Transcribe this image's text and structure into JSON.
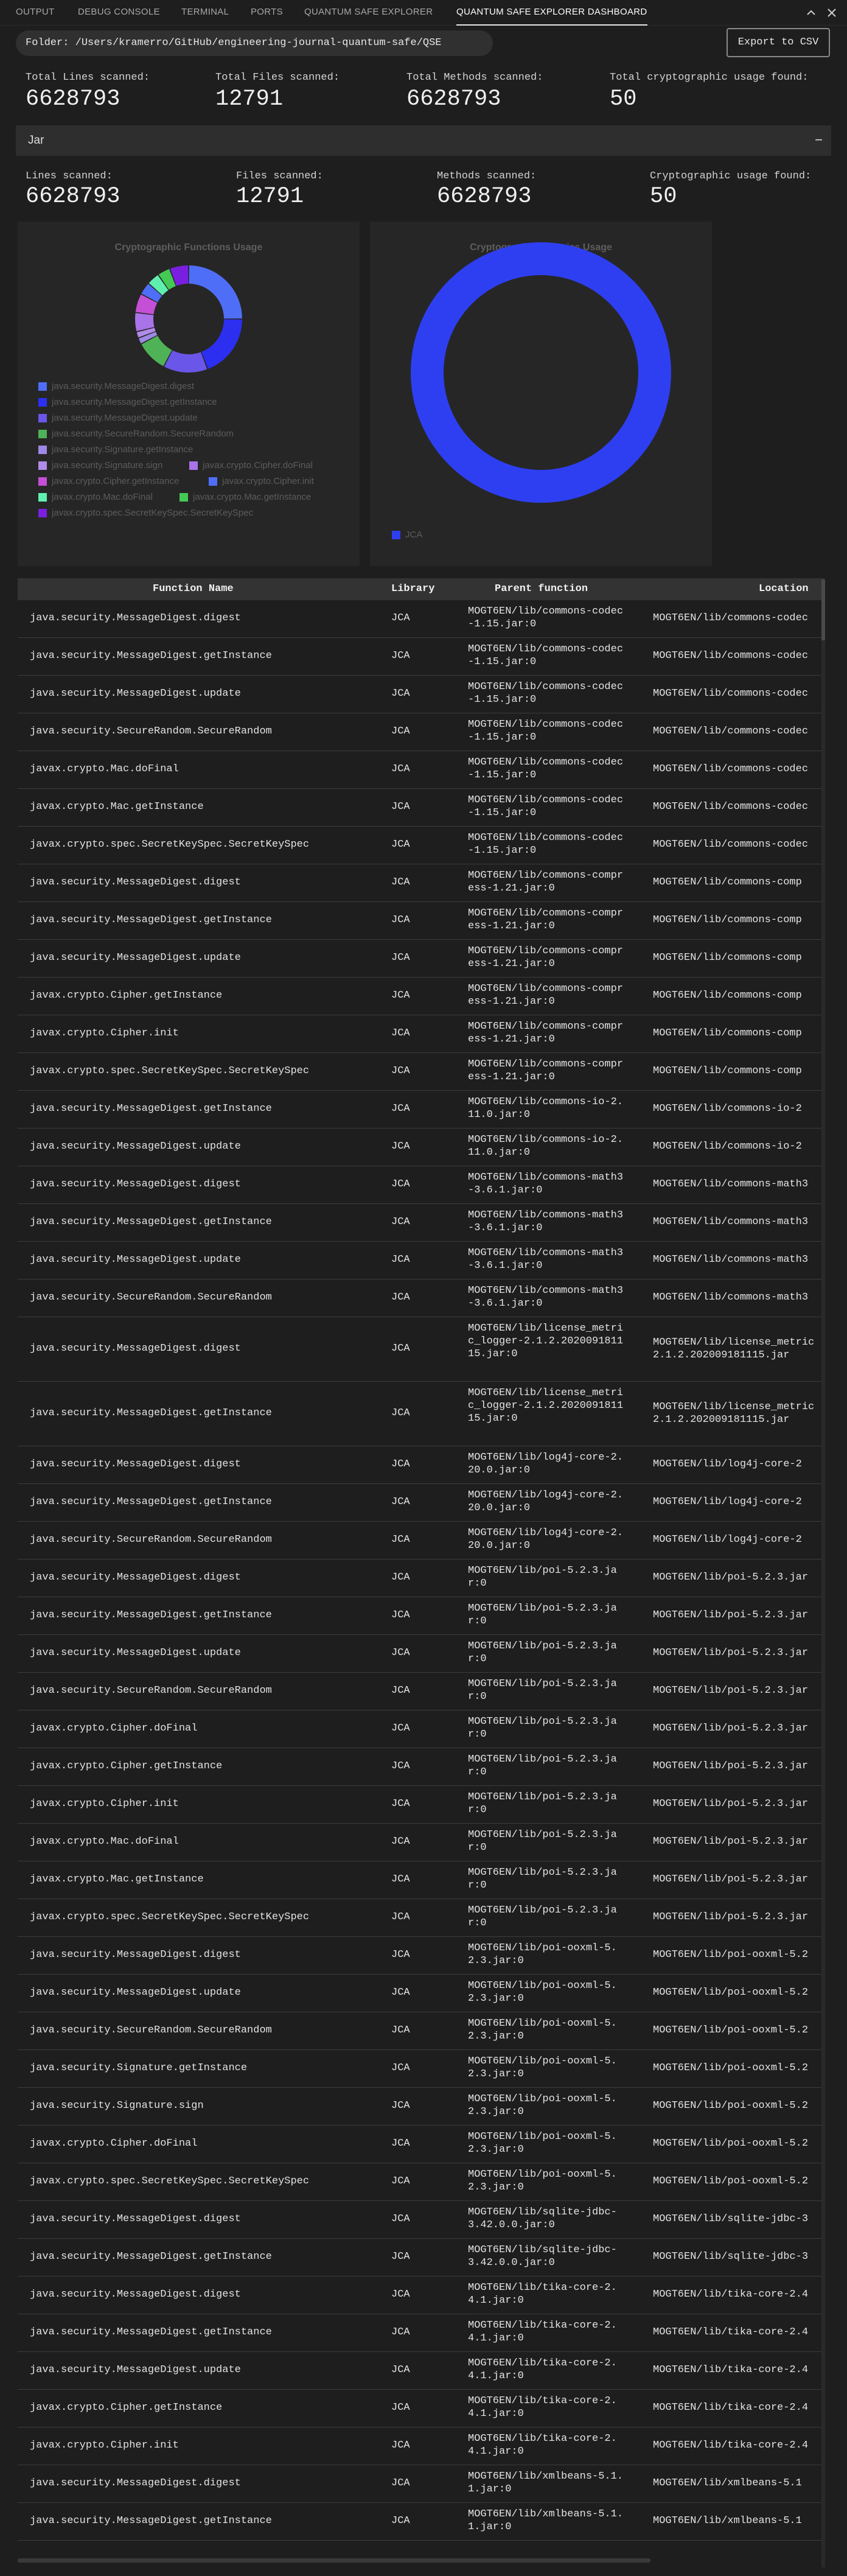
{
  "panel_tabs": [
    {
      "label": "OUTPUT",
      "active": false
    },
    {
      "label": "DEBUG CONSOLE",
      "active": false
    },
    {
      "label": "TERMINAL",
      "active": false
    },
    {
      "label": "PORTS",
      "active": false
    },
    {
      "label": "QUANTUM SAFE EXPLORER",
      "active": false
    },
    {
      "label": "QUANTUM SAFE EXPLORER DASHBOARD",
      "active": true
    }
  ],
  "panel_icons": [
    "chevron-up-icon",
    "close-icon"
  ],
  "folder": {
    "text": "Folder: /Users/kramerro/GitHub/engineering-journal-quantum-safe/QSE"
  },
  "export_button": {
    "label": "Export to CSV"
  },
  "totals": {
    "lines_label": "Total Lines scanned:",
    "lines_value": "6628793",
    "files_label": "Total Files scanned:",
    "files_value": "12791",
    "methods_label": "Total Methods scanned:",
    "methods_value": "6628793",
    "crypto_label": "Total cryptographic usage found:",
    "crypto_value": "50"
  },
  "jar_section": {
    "title": "Jar",
    "toggle": "−",
    "lines_label": "Lines scanned:",
    "lines_value": "6628793",
    "files_label": "Files scanned:",
    "files_value": "12791",
    "methods_label": "Methods scanned:",
    "methods_value": "6628793",
    "crypto_label": "Cryptographic usage found:",
    "crypto_value": "50"
  },
  "chart_data": [
    {
      "type": "pie",
      "title": "Cryptographic Functions Usage",
      "categories": [
        "java.security.MessageDigest.digest",
        "java.security.MessageDigest.getInstance",
        "java.security.MessageDigest.update",
        "java.security.SecureRandom.SecureRandom",
        "java.security.Signature.getInstance",
        "java.security.Signature.sign",
        "javax.crypto.Cipher.doFinal",
        "javax.crypto.Cipher.getInstance",
        "javax.crypto.Cipher.init",
        "javax.crypto.Mac.doFinal",
        "javax.crypto.Mac.getInstance",
        "javax.crypto.spec.SecretKeySpec.SecretKeySpec"
      ],
      "values": [
        13,
        10,
        7,
        5,
        1,
        1,
        3,
        3,
        2,
        2,
        2,
        3
      ],
      "colors": [
        "#4f6ef7",
        "#2c2ff0",
        "#6a56e8",
        "#4fb257",
        "#9d88e6",
        "#b18be9",
        "#a973ea",
        "#c54fd6",
        "#4f6ef7",
        "#5ff0b0",
        "#45c955",
        "#7a1fe0"
      ],
      "legend_position": "bottom"
    },
    {
      "type": "pie",
      "title": "Cryptographic Libraries Usage",
      "categories": [
        "JCA"
      ],
      "values": [
        50
      ],
      "colors": [
        "#2e3ff2"
      ],
      "legend_position": "bottom"
    }
  ],
  "table": {
    "columns": [
      "Function Name",
      "Library",
      "Parent function",
      "Location"
    ],
    "rows": [
      [
        "java.security.MessageDigest.digest",
        "JCA",
        "MOGT6EN/lib/commons-codec-1.15.jar:0",
        "MOGT6EN/lib/commons-codec"
      ],
      [
        "java.security.MessageDigest.getInstance",
        "JCA",
        "MOGT6EN/lib/commons-codec-1.15.jar:0",
        "MOGT6EN/lib/commons-codec"
      ],
      [
        "java.security.MessageDigest.update",
        "JCA",
        "MOGT6EN/lib/commons-codec-1.15.jar:0",
        "MOGT6EN/lib/commons-codec"
      ],
      [
        "java.security.SecureRandom.SecureRandom",
        "JCA",
        "MOGT6EN/lib/commons-codec-1.15.jar:0",
        "MOGT6EN/lib/commons-codec"
      ],
      [
        "javax.crypto.Mac.doFinal",
        "JCA",
        "MOGT6EN/lib/commons-codec-1.15.jar:0",
        "MOGT6EN/lib/commons-codec"
      ],
      [
        "javax.crypto.Mac.getInstance",
        "JCA",
        "MOGT6EN/lib/commons-codec-1.15.jar:0",
        "MOGT6EN/lib/commons-codec"
      ],
      [
        "javax.crypto.spec.SecretKeySpec.SecretKeySpec",
        "JCA",
        "MOGT6EN/lib/commons-codec-1.15.jar:0",
        "MOGT6EN/lib/commons-codec"
      ],
      [
        "java.security.MessageDigest.digest",
        "JCA",
        "MOGT6EN/lib/commons-compress-1.21.jar:0",
        "MOGT6EN/lib/commons-comp"
      ],
      [
        "java.security.MessageDigest.getInstance",
        "JCA",
        "MOGT6EN/lib/commons-compress-1.21.jar:0",
        "MOGT6EN/lib/commons-comp"
      ],
      [
        "java.security.MessageDigest.update",
        "JCA",
        "MOGT6EN/lib/commons-compress-1.21.jar:0",
        "MOGT6EN/lib/commons-comp"
      ],
      [
        "javax.crypto.Cipher.getInstance",
        "JCA",
        "MOGT6EN/lib/commons-compress-1.21.jar:0",
        "MOGT6EN/lib/commons-comp"
      ],
      [
        "javax.crypto.Cipher.init",
        "JCA",
        "MOGT6EN/lib/commons-compress-1.21.jar:0",
        "MOGT6EN/lib/commons-comp"
      ],
      [
        "javax.crypto.spec.SecretKeySpec.SecretKeySpec",
        "JCA",
        "MOGT6EN/lib/commons-compress-1.21.jar:0",
        "MOGT6EN/lib/commons-comp"
      ],
      [
        "java.security.MessageDigest.getInstance",
        "JCA",
        "MOGT6EN/lib/commons-io-2.11.0.jar:0",
        "MOGT6EN/lib/commons-io-2"
      ],
      [
        "java.security.MessageDigest.update",
        "JCA",
        "MOGT6EN/lib/commons-io-2.11.0.jar:0",
        "MOGT6EN/lib/commons-io-2"
      ],
      [
        "java.security.MessageDigest.digest",
        "JCA",
        "MOGT6EN/lib/commons-math3-3.6.1.jar:0",
        "MOGT6EN/lib/commons-math3"
      ],
      [
        "java.security.MessageDigest.getInstance",
        "JCA",
        "MOGT6EN/lib/commons-math3-3.6.1.jar:0",
        "MOGT6EN/lib/commons-math3"
      ],
      [
        "java.security.MessageDigest.update",
        "JCA",
        "MOGT6EN/lib/commons-math3-3.6.1.jar:0",
        "MOGT6EN/lib/commons-math3"
      ],
      [
        "java.security.SecureRandom.SecureRandom",
        "JCA",
        "MOGT6EN/lib/commons-math3-3.6.1.jar:0",
        "MOGT6EN/lib/commons-math3"
      ],
      [
        "java.security.MessageDigest.digest",
        "JCA",
        "MOGT6EN/lib/license_metric_logger-2.1.2.202009181115.jar:0",
        "MOGT6EN/lib/license_metric|2.1.2.202009181115.jar"
      ],
      [
        "java.security.MessageDigest.getInstance",
        "JCA",
        "MOGT6EN/lib/license_metric_logger-2.1.2.202009181115.jar:0",
        "MOGT6EN/lib/license_metric|2.1.2.202009181115.jar"
      ],
      [
        "java.security.MessageDigest.digest",
        "JCA",
        "MOGT6EN/lib/log4j-core-2.20.0.jar:0",
        "MOGT6EN/lib/log4j-core-2"
      ],
      [
        "java.security.MessageDigest.getInstance",
        "JCA",
        "MOGT6EN/lib/log4j-core-2.20.0.jar:0",
        "MOGT6EN/lib/log4j-core-2"
      ],
      [
        "java.security.SecureRandom.SecureRandom",
        "JCA",
        "MOGT6EN/lib/log4j-core-2.20.0.jar:0",
        "MOGT6EN/lib/log4j-core-2"
      ],
      [
        "java.security.MessageDigest.digest",
        "JCA",
        "MOGT6EN/lib/poi-5.2.3.jar:0",
        "MOGT6EN/lib/poi-5.2.3.jar"
      ],
      [
        "java.security.MessageDigest.getInstance",
        "JCA",
        "MOGT6EN/lib/poi-5.2.3.jar:0",
        "MOGT6EN/lib/poi-5.2.3.jar"
      ],
      [
        "java.security.MessageDigest.update",
        "JCA",
        "MOGT6EN/lib/poi-5.2.3.jar:0",
        "MOGT6EN/lib/poi-5.2.3.jar"
      ],
      [
        "java.security.SecureRandom.SecureRandom",
        "JCA",
        "MOGT6EN/lib/poi-5.2.3.jar:0",
        "MOGT6EN/lib/poi-5.2.3.jar"
      ],
      [
        "javax.crypto.Cipher.doFinal",
        "JCA",
        "MOGT6EN/lib/poi-5.2.3.jar:0",
        "MOGT6EN/lib/poi-5.2.3.jar"
      ],
      [
        "javax.crypto.Cipher.getInstance",
        "JCA",
        "MOGT6EN/lib/poi-5.2.3.jar:0",
        "MOGT6EN/lib/poi-5.2.3.jar"
      ],
      [
        "javax.crypto.Cipher.init",
        "JCA",
        "MOGT6EN/lib/poi-5.2.3.jar:0",
        "MOGT6EN/lib/poi-5.2.3.jar"
      ],
      [
        "javax.crypto.Mac.doFinal",
        "JCA",
        "MOGT6EN/lib/poi-5.2.3.jar:0",
        "MOGT6EN/lib/poi-5.2.3.jar"
      ],
      [
        "javax.crypto.Mac.getInstance",
        "JCA",
        "MOGT6EN/lib/poi-5.2.3.jar:0",
        "MOGT6EN/lib/poi-5.2.3.jar"
      ],
      [
        "javax.crypto.spec.SecretKeySpec.SecretKeySpec",
        "JCA",
        "MOGT6EN/lib/poi-5.2.3.jar:0",
        "MOGT6EN/lib/poi-5.2.3.jar"
      ],
      [
        "java.security.MessageDigest.digest",
        "JCA",
        "MOGT6EN/lib/poi-ooxml-5.2.3.jar:0",
        "MOGT6EN/lib/poi-ooxml-5.2"
      ],
      [
        "java.security.MessageDigest.update",
        "JCA",
        "MOGT6EN/lib/poi-ooxml-5.2.3.jar:0",
        "MOGT6EN/lib/poi-ooxml-5.2"
      ],
      [
        "java.security.SecureRandom.SecureRandom",
        "JCA",
        "MOGT6EN/lib/poi-ooxml-5.2.3.jar:0",
        "MOGT6EN/lib/poi-ooxml-5.2"
      ],
      [
        "java.security.Signature.getInstance",
        "JCA",
        "MOGT6EN/lib/poi-ooxml-5.2.3.jar:0",
        "MOGT6EN/lib/poi-ooxml-5.2"
      ],
      [
        "java.security.Signature.sign",
        "JCA",
        "MOGT6EN/lib/poi-ooxml-5.2.3.jar:0",
        "MOGT6EN/lib/poi-ooxml-5.2"
      ],
      [
        "javax.crypto.Cipher.doFinal",
        "JCA",
        "MOGT6EN/lib/poi-ooxml-5.2.3.jar:0",
        "MOGT6EN/lib/poi-ooxml-5.2"
      ],
      [
        "javax.crypto.spec.SecretKeySpec.SecretKeySpec",
        "JCA",
        "MOGT6EN/lib/poi-ooxml-5.2.3.jar:0",
        "MOGT6EN/lib/poi-ooxml-5.2"
      ],
      [
        "java.security.MessageDigest.digest",
        "JCA",
        "MOGT6EN/lib/sqlite-jdbc-3.42.0.0.jar:0",
        "MOGT6EN/lib/sqlite-jdbc-3"
      ],
      [
        "java.security.MessageDigest.getInstance",
        "JCA",
        "MOGT6EN/lib/sqlite-jdbc-3.42.0.0.jar:0",
        "MOGT6EN/lib/sqlite-jdbc-3"
      ],
      [
        "java.security.MessageDigest.digest",
        "JCA",
        "MOGT6EN/lib/tika-core-2.4.1.jar:0",
        "MOGT6EN/lib/tika-core-2.4"
      ],
      [
        "java.security.MessageDigest.getInstance",
        "JCA",
        "MOGT6EN/lib/tika-core-2.4.1.jar:0",
        "MOGT6EN/lib/tika-core-2.4"
      ],
      [
        "java.security.MessageDigest.update",
        "JCA",
        "MOGT6EN/lib/tika-core-2.4.1.jar:0",
        "MOGT6EN/lib/tika-core-2.4"
      ],
      [
        "javax.crypto.Cipher.getInstance",
        "JCA",
        "MOGT6EN/lib/tika-core-2.4.1.jar:0",
        "MOGT6EN/lib/tika-core-2.4"
      ],
      [
        "javax.crypto.Cipher.init",
        "JCA",
        "MOGT6EN/lib/tika-core-2.4.1.jar:0",
        "MOGT6EN/lib/tika-core-2.4"
      ],
      [
        "java.security.MessageDigest.digest",
        "JCA",
        "MOGT6EN/lib/xmlbeans-5.1.1.jar:0",
        "MOGT6EN/lib/xmlbeans-5.1"
      ],
      [
        "java.security.MessageDigest.getInstance",
        "JCA",
        "MOGT6EN/lib/xmlbeans-5.1.1.jar:0",
        "MOGT6EN/lib/xmlbeans-5.1"
      ]
    ]
  }
}
